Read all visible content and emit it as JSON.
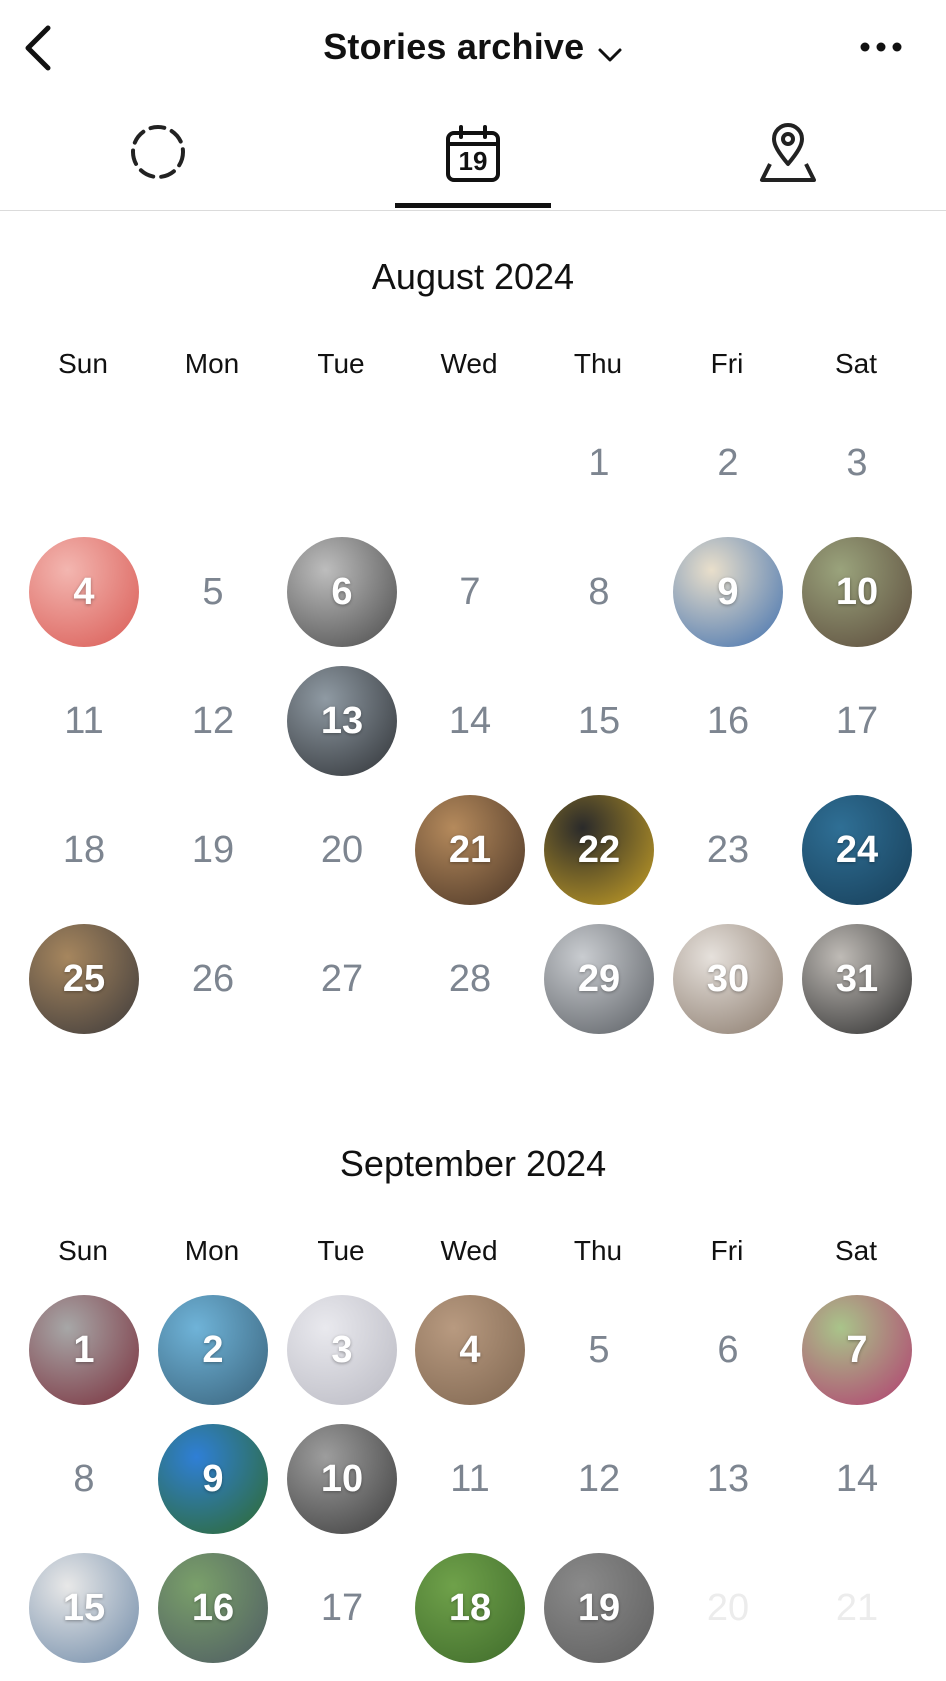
{
  "header": {
    "title": "Stories archive"
  },
  "icons": {
    "back": "back-chevron-icon",
    "title_dropdown": "chevron-down-icon",
    "more": "more-options-icon",
    "tab_stories": "dashed-circle-icon",
    "tab_calendar": "calendar-icon",
    "tab_map": "map-pin-icon"
  },
  "tabs": [
    {
      "name": "stories",
      "selected": false
    },
    {
      "name": "calendar",
      "calendar_day": "19",
      "selected": true
    },
    {
      "name": "map",
      "selected": false
    }
  ],
  "weekdays": [
    "Sun",
    "Mon",
    "Tue",
    "Wed",
    "Thu",
    "Fri",
    "Sat"
  ],
  "months": [
    {
      "title": "August 2024",
      "first_weekday": 4,
      "days_shown": 31,
      "story_days": [
        4,
        6,
        9,
        10,
        13,
        21,
        22,
        24,
        25,
        29,
        30,
        31
      ],
      "faded_days": [],
      "story_colors": {
        "4": [
          "#f3b6b0",
          "#d95a54"
        ],
        "6": [
          "#bdbdbd",
          "#4a4a4a"
        ],
        "9": [
          "#e9dfcb",
          "#3f6fae"
        ],
        "10": [
          "#9aa37c",
          "#5b4a3b"
        ],
        "13": [
          "#8f9aa3",
          "#2f3236"
        ],
        "21": [
          "#b58a5c",
          "#4a3526"
        ],
        "22": [
          "#2a2a2a",
          "#c9a226"
        ],
        "24": [
          "#2f6f95",
          "#173e58"
        ],
        "25": [
          "#a6865e",
          "#3d3a3b"
        ],
        "29": [
          "#c9ccd0",
          "#5a5e63"
        ],
        "30": [
          "#e6e1dc",
          "#8a7a6c"
        ],
        "31": [
          "#bfbbb6",
          "#2d2d2d"
        ]
      }
    },
    {
      "title": "September 2024",
      "first_weekday": 0,
      "days_shown": 21,
      "story_days": [
        1,
        2,
        3,
        4,
        7,
        9,
        10,
        15,
        16,
        18,
        19
      ],
      "faded_days": [
        20,
        21
      ],
      "story_colors": {
        "1": [
          "#a7a7a7",
          "#7a2f3c"
        ],
        "2": [
          "#6fb3d8",
          "#39627a"
        ],
        "3": [
          "#e9e9ee",
          "#b9b9c2"
        ],
        "4": [
          "#b89a80",
          "#7f6650"
        ],
        "7": [
          "#a9c48a",
          "#b23c70"
        ],
        "9": [
          "#2f7fd6",
          "#2f6a2b"
        ],
        "10": [
          "#9d9d9d",
          "#3d3d3d"
        ],
        "15": [
          "#e8e8e8",
          "#6f8aa8"
        ],
        "16": [
          "#7aa06a",
          "#4e5b63"
        ],
        "18": [
          "#6fa14a",
          "#3f6b2b"
        ],
        "19": [
          "#8a8a8a",
          "#5e5e5e"
        ]
      }
    }
  ]
}
